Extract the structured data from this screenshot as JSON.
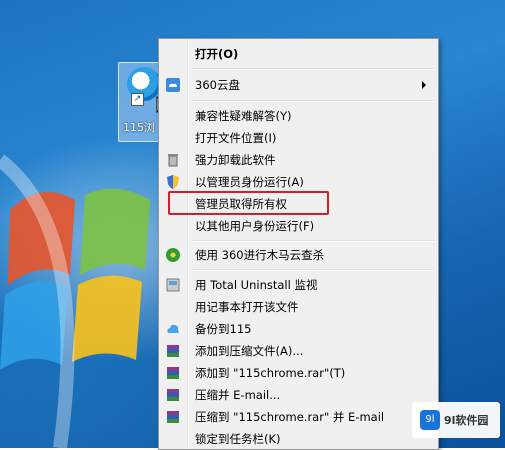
{
  "desktop": {
    "shortcut_label": "115浏",
    "shortcut_arrow": "↗"
  },
  "menu": {
    "items": [
      {
        "label": "打开(O)",
        "bold": true,
        "icon": "none"
      },
      {
        "label": "360云盘",
        "submenu": true,
        "icon": "cloud-360-icon"
      },
      {
        "label": "兼容性疑难解答(Y)",
        "icon": "none"
      },
      {
        "label": "打开文件位置(I)",
        "icon": "none"
      },
      {
        "label": "强力卸载此软件",
        "icon": "trash-icon"
      },
      {
        "label": "以管理员身份运行(A)",
        "icon": "shield-icon"
      },
      {
        "label": "管理员取得所有权",
        "icon": "none"
      },
      {
        "label": "以其他用户身份运行(F)",
        "icon": "none"
      },
      {
        "label": "使用 360进行木马云查杀",
        "icon": "antivirus-360-icon"
      },
      {
        "label": "用 Total Uninstall 监视",
        "icon": "total-uninstall-icon"
      },
      {
        "label": "用记事本打开该文件",
        "icon": "none"
      },
      {
        "label": "备份到115",
        "icon": "cloud-115-icon"
      },
      {
        "label": "添加到压缩文件(A)...",
        "icon": "winrar-icon"
      },
      {
        "label": "添加到 \"115chrome.rar\"(T)",
        "icon": "winrar-icon"
      },
      {
        "label": "压缩并 E-mail...",
        "icon": "winrar-icon"
      },
      {
        "label": "压缩到 \"115chrome.rar\" 并 E-mail",
        "icon": "winrar-icon"
      },
      {
        "label": "锁定到任务栏(K)",
        "icon": "none"
      }
    ]
  },
  "watermark": {
    "logo": "9l",
    "text": "9l软件园"
  },
  "colors": {
    "highlight_border": "#d0202a",
    "menu_bg": "#f0f0f0"
  }
}
